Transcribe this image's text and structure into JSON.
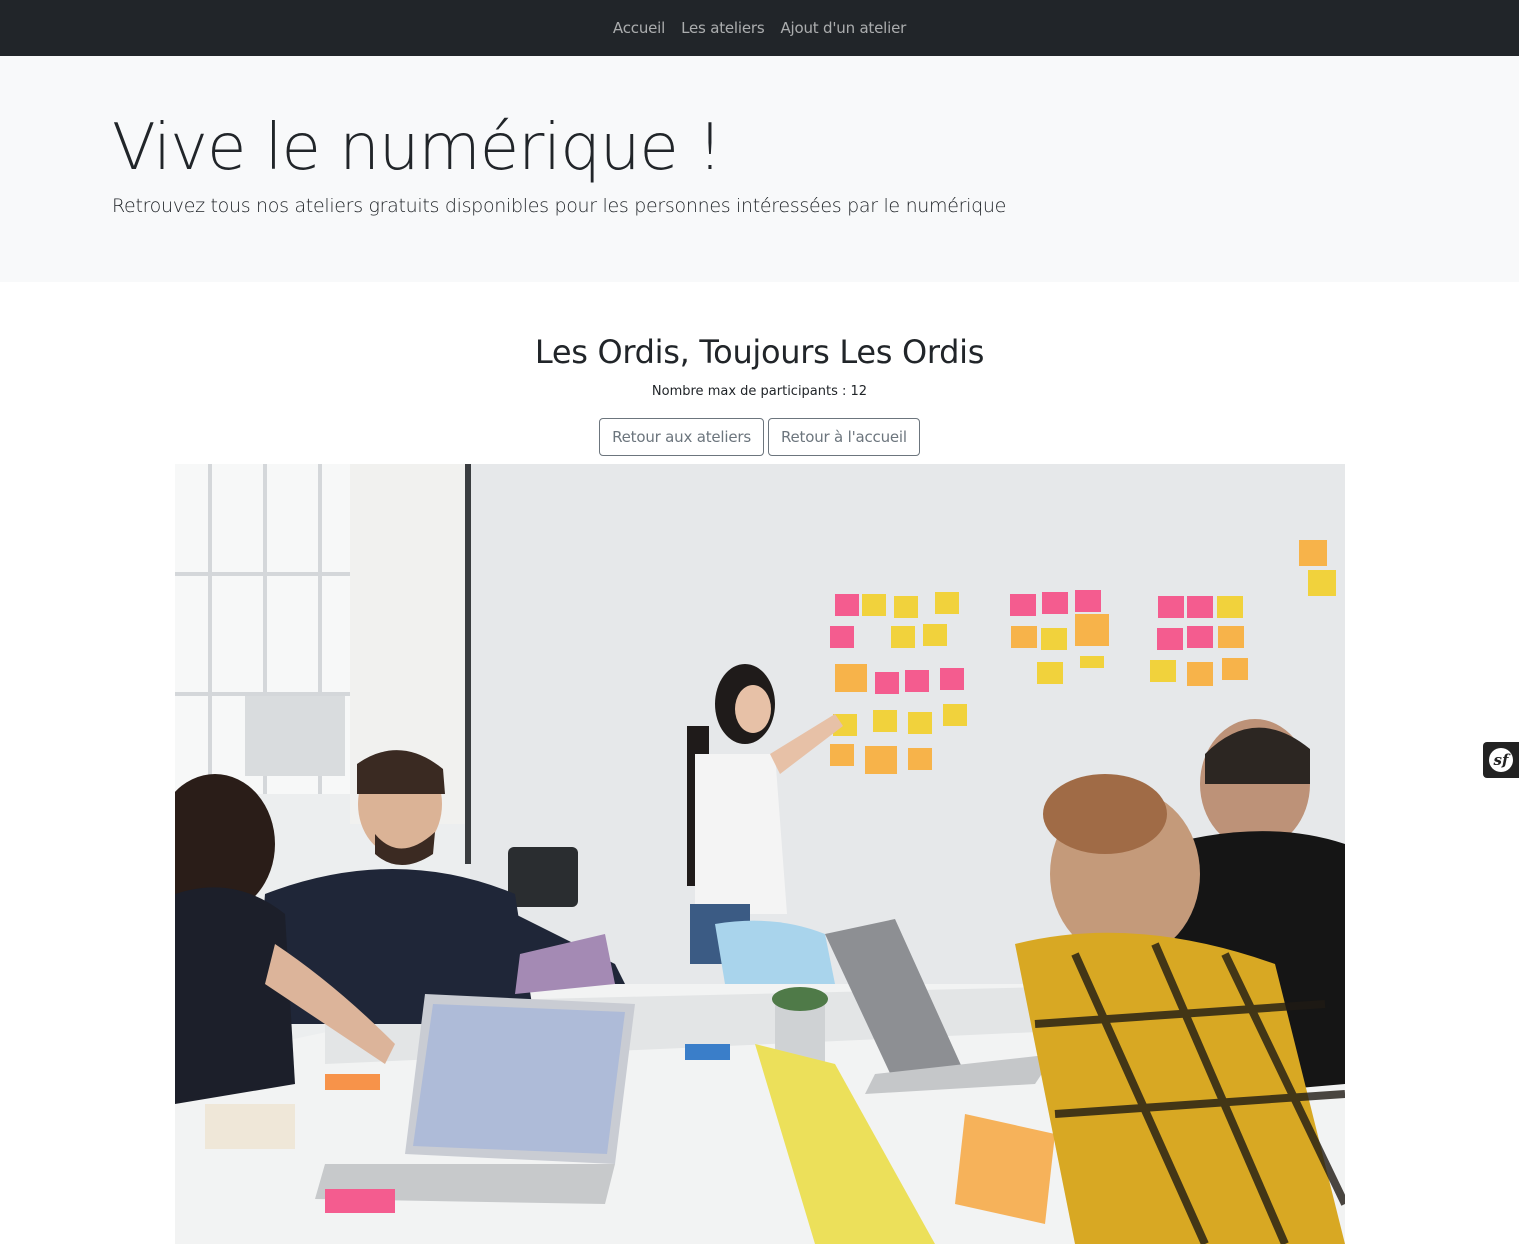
{
  "navbar": {
    "links": [
      {
        "label": "Accueil"
      },
      {
        "label": "Les ateliers"
      },
      {
        "label": "Ajout d'un atelier"
      }
    ]
  },
  "hero": {
    "title": "Vive le numérique !",
    "lead": "Retrouvez tous nos ateliers gratuits disponibles pour les personnes intéressées par le numérique"
  },
  "workshop": {
    "title": "Les Ordis, Toujours Les Ordis",
    "participants_label": "Nombre max de participants : ",
    "participants_value": "12",
    "back_to_workshops": "Retour aux ateliers",
    "back_to_home": "Retour à l'accueil",
    "photo_icon": "workshop-photo"
  },
  "debug_toolbar": {
    "icon": "symfony-icon",
    "logo_text": "sf"
  },
  "colors": {
    "navbar_bg": "#212529",
    "hero_bg": "#f8f9fa",
    "button_outline": "#6c757d"
  }
}
